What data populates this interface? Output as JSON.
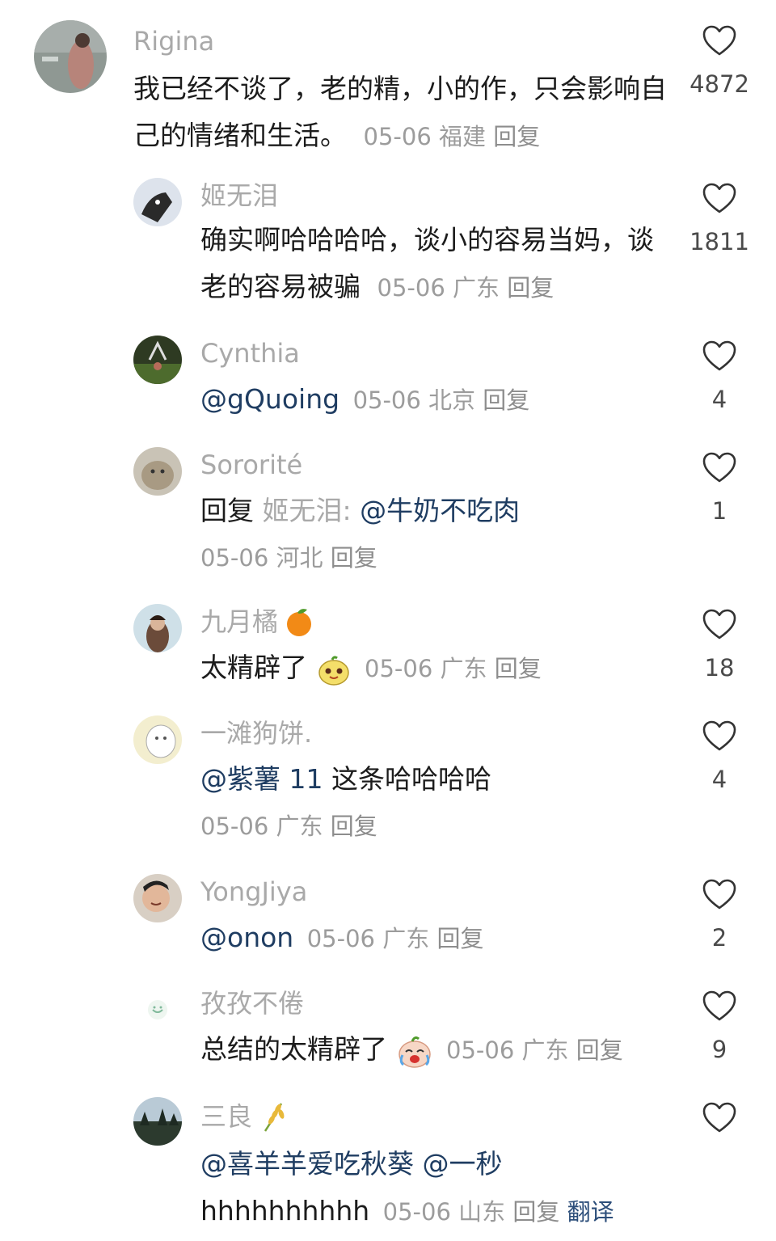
{
  "comments": [
    {
      "user": "Rigina",
      "text": "我已经不谈了，老的精，小的作，只会影响自己的情绪和生活。",
      "meta": "05-06 福建",
      "reply": "回复",
      "likes": "4872"
    },
    {
      "user": "姬无泪",
      "text": "确实啊哈哈哈哈，谈小的容易当妈，谈老的容易被骗",
      "meta": "05-06 广东",
      "reply": "回复",
      "likes": "1811"
    },
    {
      "user": "Cynthia",
      "mention": "@gQuoing",
      "meta": "05-06 北京",
      "reply": "回复",
      "likes": "4"
    },
    {
      "user": "Sororité",
      "reply_prefix": "回复",
      "reply_to": "姬无泪:",
      "mention": "@牛奶不吃肉",
      "meta": "05-06 河北",
      "reply": "回复",
      "likes": "1"
    },
    {
      "user": "九月橘",
      "text": "太精辟了",
      "meta": "05-06 广东",
      "reply": "回复",
      "likes": "18"
    },
    {
      "user": "一滩狗饼.",
      "mention": "@紫薯 11",
      "text": "这条哈哈哈哈",
      "meta": "05-06 广东",
      "reply": "回复",
      "likes": "4"
    },
    {
      "user": "YongJiya",
      "mention": "@onon",
      "meta": "05-06 广东",
      "reply": "回复",
      "likes": "2"
    },
    {
      "user": "孜孜不倦",
      "text": "总结的太精辟了",
      "meta": "05-06 广东",
      "reply": "回复",
      "likes": "9"
    },
    {
      "user": "三良",
      "mention": "@喜羊羊爱吃秋葵",
      "mention2": "@一秒",
      "text": "hhhhhhhhhh",
      "meta": "05-06 山东",
      "reply": "回复",
      "translate": "翻译",
      "likes": ""
    }
  ],
  "icons": {
    "like": "heart-outline-icon"
  }
}
